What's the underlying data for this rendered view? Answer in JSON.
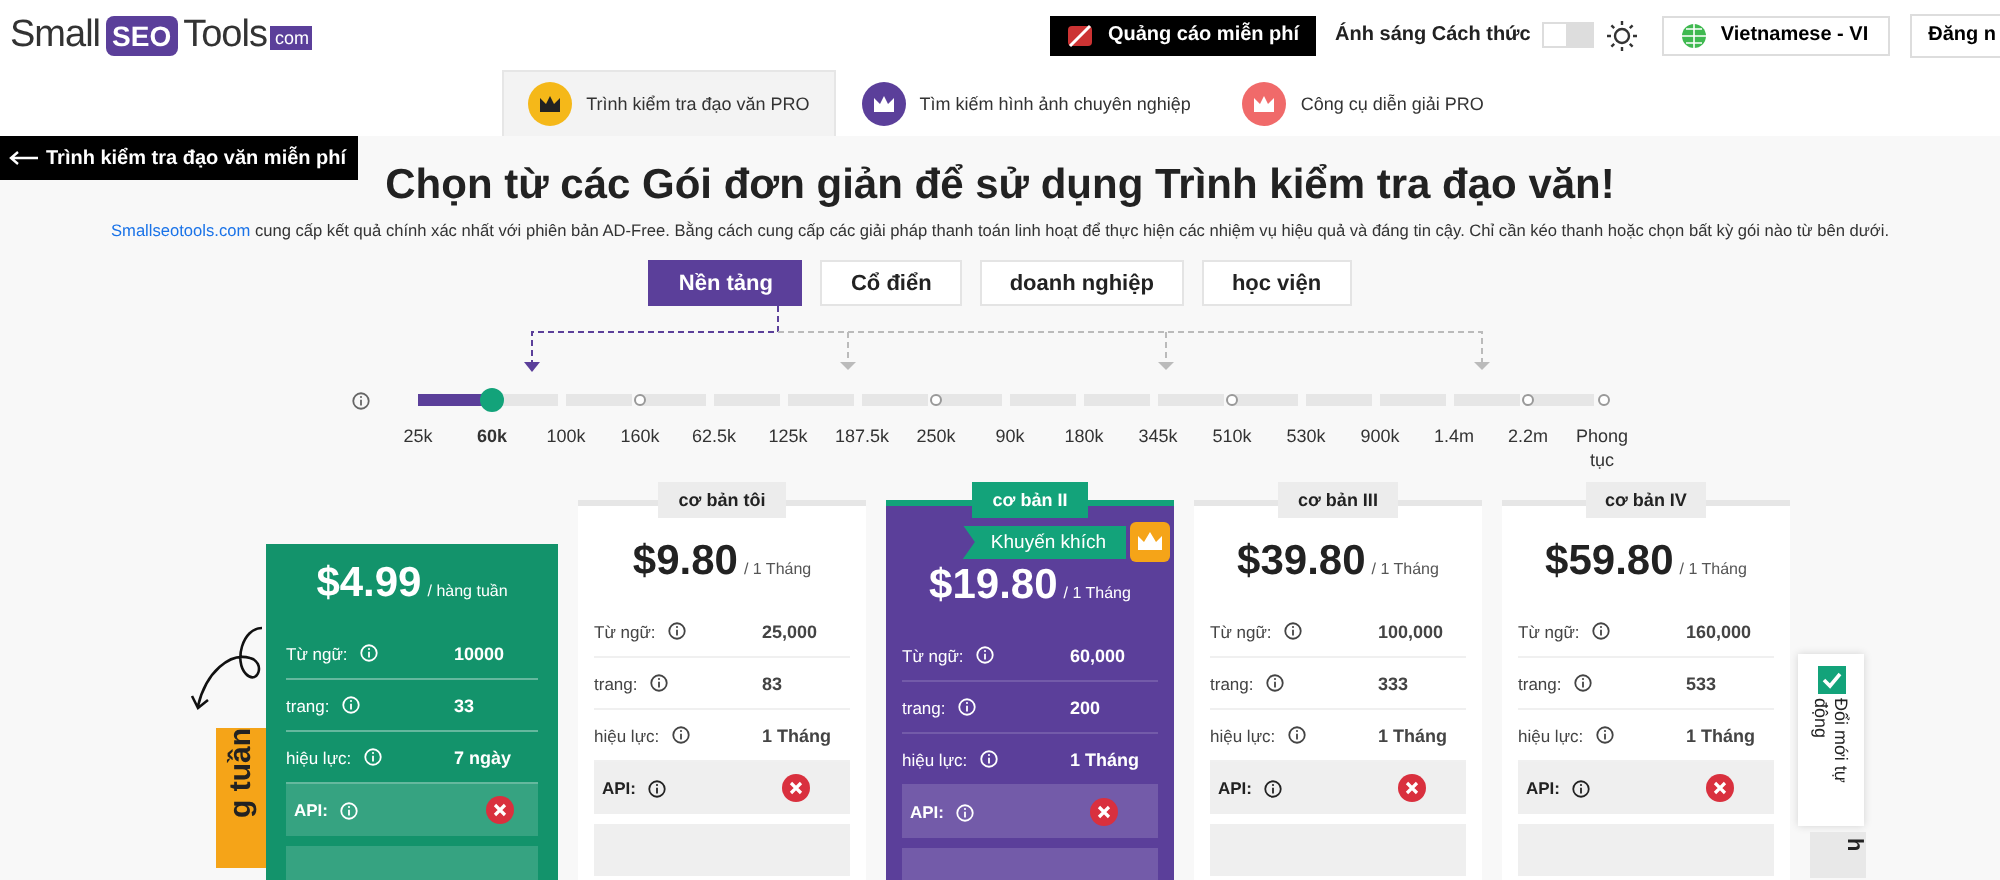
{
  "logo": {
    "parts": [
      "Small",
      "SEO",
      "Tools",
      "com"
    ]
  },
  "header": {
    "ads_button": "Quảng cáo miễn phí",
    "theme_label": "Ánh sáng Cách thức",
    "theme_toggle": {
      "on": false
    },
    "language": "Vietnamese - VI",
    "login": "Đăng n"
  },
  "tabs": [
    {
      "label": "Trình kiểm tra đạo văn PRO",
      "selected": true,
      "color": "#f5b819"
    },
    {
      "label": "Tìm kiếm hình ảnh chuyên nghiệp",
      "selected": false,
      "color": "#5b3f9a"
    },
    {
      "label": "Công cụ diễn giải PRO",
      "selected": false,
      "color": "#f06a6a"
    }
  ],
  "back_link": "Trình kiểm tra đạo văn miễn phí",
  "title": "Chọn từ các Gói đơn giản để sử dụng Trình kiểm tra đạo văn!",
  "description": {
    "link": "Smallseotools.com",
    "text": "cung cấp kết quả chính xác nhất với phiên bản AD-Free. Bằng cách cung cấp các giải pháp thanh toán linh hoạt để thực hiện các nhiệm vụ hiệu quả và đáng tin cậy. Chỉ cần kéo thanh hoặc chọn bất kỳ gói nào từ bên dưới."
  },
  "segments": [
    {
      "label": "Nền tảng",
      "selected": true
    },
    {
      "label": "Cổ điển",
      "selected": false
    },
    {
      "label": "doanh nghiệp",
      "selected": false
    },
    {
      "label": "học viện",
      "selected": false
    }
  ],
  "slider": {
    "level": 0.0625,
    "stops": [
      {
        "label": "25k",
        "selected": false,
        "tick": false
      },
      {
        "label": "60k",
        "selected": true,
        "tick": false
      },
      {
        "label": "100k",
        "selected": false,
        "tick": false
      },
      {
        "label": "160k",
        "selected": false,
        "tick": true
      },
      {
        "label": "62.5k",
        "selected": false,
        "tick": false
      },
      {
        "label": "125k",
        "selected": false,
        "tick": false
      },
      {
        "label": "187.5k",
        "selected": false,
        "tick": false
      },
      {
        "label": "250k",
        "selected": false,
        "tick": true
      },
      {
        "label": "90k",
        "selected": false,
        "tick": false
      },
      {
        "label": "180k",
        "selected": false,
        "tick": false
      },
      {
        "label": "345k",
        "selected": false,
        "tick": false
      },
      {
        "label": "510k",
        "selected": false,
        "tick": true
      },
      {
        "label": "530k",
        "selected": false,
        "tick": false
      },
      {
        "label": "900k",
        "selected": false,
        "tick": false
      },
      {
        "label": "1.4m",
        "selected": false,
        "tick": false
      },
      {
        "label": "2.2m",
        "selected": false,
        "tick": true
      },
      {
        "label": "Phong tục",
        "selected": false,
        "tick": true
      }
    ]
  },
  "weekly_strip": "g tuần",
  "plans": [
    {
      "kind": "weekly",
      "price": "$4.99",
      "period": "/ hàng tuần",
      "rows": [
        {
          "kind": "text",
          "label": "Từ ngữ:",
          "value": "10000"
        },
        {
          "kind": "text",
          "label": "trang:",
          "value": "33"
        },
        {
          "kind": "text",
          "label": "hiệu lực:",
          "value": "7 ngày"
        },
        {
          "kind": "cross",
          "label": "API:"
        }
      ]
    },
    {
      "kind": "plan",
      "featured": false,
      "label": "cơ bản tôi",
      "price": "$9.80",
      "period": "/ 1 Tháng",
      "rows": [
        {
          "kind": "text",
          "label": "Từ ngữ:",
          "value": "25,000"
        },
        {
          "kind": "text",
          "label": "trang:",
          "value": "83"
        },
        {
          "kind": "text",
          "label": "hiệu lực:",
          "value": "1 Tháng"
        },
        {
          "kind": "cross",
          "label": "API:"
        }
      ]
    },
    {
      "kind": "plan",
      "featured": true,
      "label": "cơ bản II",
      "ribbon": "Khuyến khích",
      "price": "$19.80",
      "period": "/ 1 Tháng",
      "rows": [
        {
          "kind": "text",
          "label": "Từ ngữ:",
          "value": "60,000"
        },
        {
          "kind": "text",
          "label": "trang:",
          "value": "200"
        },
        {
          "kind": "text",
          "label": "hiệu lực:",
          "value": "1 Tháng"
        },
        {
          "kind": "cross",
          "label": "API:"
        }
      ]
    },
    {
      "kind": "plan",
      "featured": false,
      "label": "cơ bản III",
      "price": "$39.80",
      "period": "/ 1 Tháng",
      "rows": [
        {
          "kind": "text",
          "label": "Từ ngữ:",
          "value": "100,000"
        },
        {
          "kind": "text",
          "label": "trang:",
          "value": "333"
        },
        {
          "kind": "text",
          "label": "hiệu lực:",
          "value": "1 Tháng"
        },
        {
          "kind": "cross",
          "label": "API:"
        }
      ]
    },
    {
      "kind": "plan",
      "featured": false,
      "label": "cơ bản IV",
      "price": "$59.80",
      "period": "/ 1 Tháng",
      "rows": [
        {
          "kind": "text",
          "label": "Từ ngữ:",
          "value": "160,000"
        },
        {
          "kind": "text",
          "label": "trang:",
          "value": "533"
        },
        {
          "kind": "text",
          "label": "hiệu lực:",
          "value": "1 Tháng"
        },
        {
          "kind": "cross",
          "label": "API:"
        }
      ]
    }
  ],
  "side_tab": "Đổi mới tự động",
  "side_tab_2": "h"
}
